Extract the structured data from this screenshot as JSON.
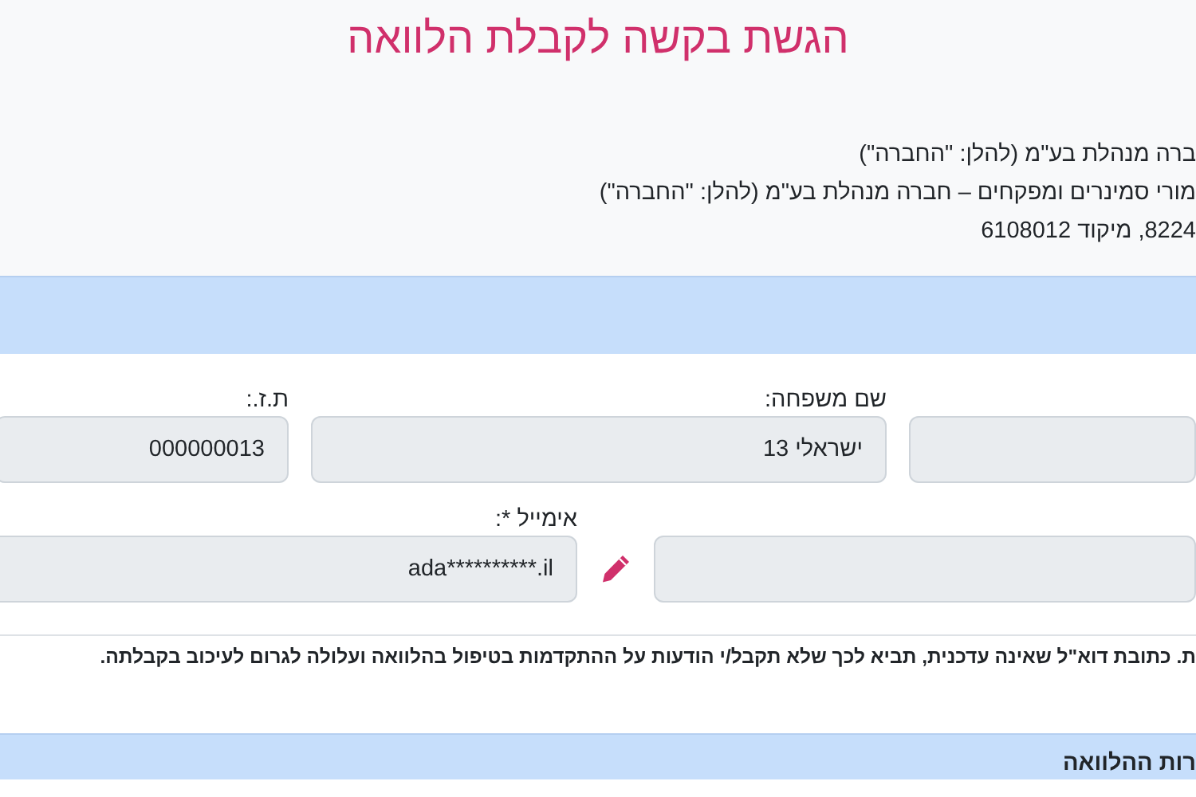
{
  "title": "הגשת בקשה לקבלת הלוואה",
  "company_lines": [
    "ברה מנהלת בע\"מ (להלן: \"החברה\")",
    "מורי סמינרים ומפקחים – חברה מנהלת בע\"מ (להלן: \"החברה\")",
    "8224, מיקוד 6108012"
  ],
  "fields_row_1": [
    {
      "disabled": true
    },
    {
      "label": "שם משפחה:",
      "value": "ישראלי 13",
      "disabled": true
    },
    {
      "label": "ת.ז.:",
      "value": "000000013",
      "disabled": true
    }
  ],
  "fields_row_2": [
    {
      "disabled": true
    },
    {
      "label": "אימייל *:",
      "value": "ada**********.il",
      "disabled": true,
      "editable": true
    }
  ],
  "email_note": "ת. כתובת דוא\"ל שאינה עדכנית, תביא לכך שלא תקבל/י הודעות על ההתקדמות בטיפול בהלוואה ועלולה לגרום לעיכוב בקבלתה.",
  "section_heading": "רות ההלוואה"
}
